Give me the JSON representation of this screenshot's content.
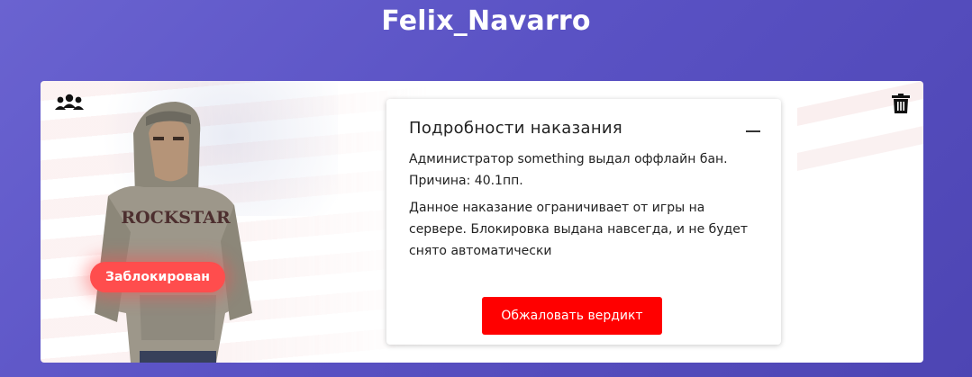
{
  "header": {
    "title": "Felix_Navarro"
  },
  "card": {
    "status_badge": "Заблокирован",
    "icons": {
      "group": "group-users-icon",
      "delete": "trash-icon"
    },
    "details": {
      "title": "Подробности наказания",
      "line1": "Администратор something выдал оффлайн бан.",
      "line2": "Причина: 40.1пп.",
      "line3": "Данное наказание ограничивает от игры на сервере. Блокировка выдана навсегда, и не будет снято автоматически",
      "appeal_label": "Обжаловать вердикт"
    }
  },
  "colors": {
    "background": "#5a52c4",
    "badge": "#ff4d4d",
    "appeal_button": "#ff0000"
  }
}
